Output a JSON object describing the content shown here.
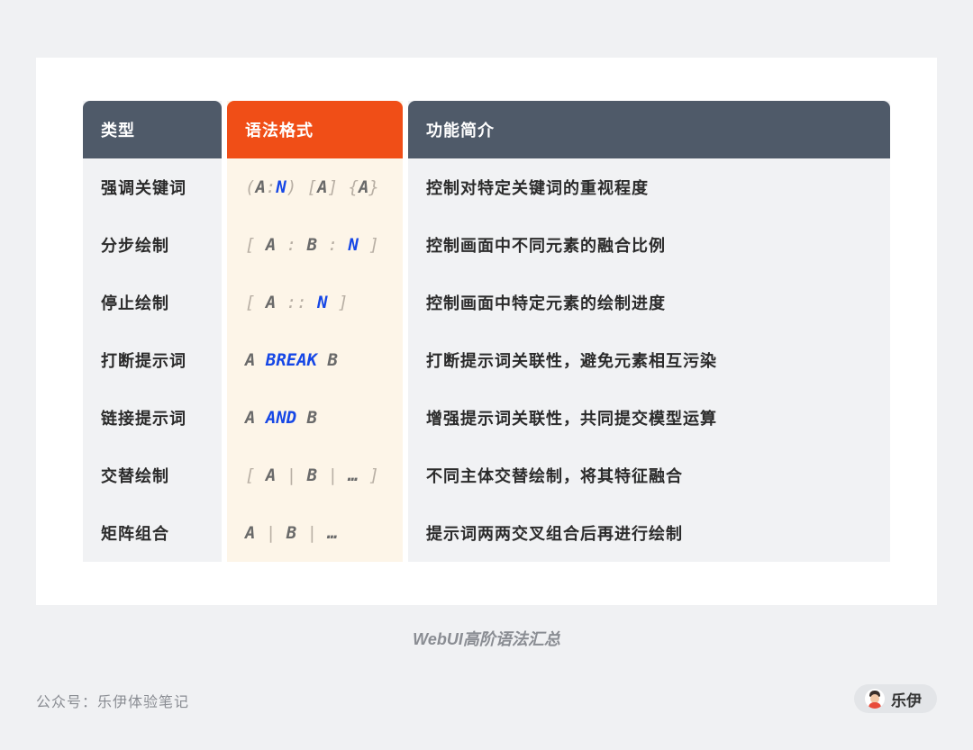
{
  "table": {
    "headers": {
      "type": "类型",
      "syntax": "语法格式",
      "desc": "功能简介"
    },
    "rows": [
      {
        "type": "强调关键词",
        "syntax": [
          {
            "t": "(",
            "k": "bracket"
          },
          {
            "t": "A",
            "k": "letter"
          },
          {
            "t": ":",
            "k": "sep"
          },
          {
            "t": "N",
            "k": "key"
          },
          {
            "t": ") ",
            "k": "bracket"
          },
          {
            "t": "[",
            "k": "bracket"
          },
          {
            "t": "A",
            "k": "letter"
          },
          {
            "t": "] ",
            "k": "bracket"
          },
          {
            "t": "{",
            "k": "bracket"
          },
          {
            "t": "A",
            "k": "letter"
          },
          {
            "t": "}",
            "k": "bracket"
          }
        ],
        "desc": "控制对特定关键词的重视程度"
      },
      {
        "type": "分步绘制",
        "syntax": [
          {
            "t": "[ ",
            "k": "bracket"
          },
          {
            "t": "A",
            "k": "letter"
          },
          {
            "t": " : ",
            "k": "sep"
          },
          {
            "t": "B",
            "k": "letter"
          },
          {
            "t": " : ",
            "k": "sep"
          },
          {
            "t": "N",
            "k": "key"
          },
          {
            "t": " ]",
            "k": "bracket"
          }
        ],
        "desc": "控制画面中不同元素的融合比例"
      },
      {
        "type": "停止绘制",
        "syntax": [
          {
            "t": "[ ",
            "k": "bracket"
          },
          {
            "t": "A",
            "k": "letter"
          },
          {
            "t": " :: ",
            "k": "sep"
          },
          {
            "t": "N",
            "k": "key"
          },
          {
            "t": " ]",
            "k": "bracket"
          }
        ],
        "desc": "控制画面中特定元素的绘制进度"
      },
      {
        "type": "打断提示词",
        "syntax": [
          {
            "t": "A ",
            "k": "letter"
          },
          {
            "t": "BREAK",
            "k": "key"
          },
          {
            "t": " B",
            "k": "letter"
          }
        ],
        "desc": "打断提示词关联性，避免元素相互污染"
      },
      {
        "type": "链接提示词",
        "syntax": [
          {
            "t": "A ",
            "k": "letter"
          },
          {
            "t": "AND",
            "k": "key"
          },
          {
            "t": " B",
            "k": "letter"
          }
        ],
        "desc": "增强提示词关联性，共同提交模型运算"
      },
      {
        "type": "交替绘制",
        "syntax": [
          {
            "t": "[ ",
            "k": "bracket"
          },
          {
            "t": "A",
            "k": "letter"
          },
          {
            "t": " | ",
            "k": "sep"
          },
          {
            "t": "B",
            "k": "letter"
          },
          {
            "t": " | ",
            "k": "sep"
          },
          {
            "t": "…",
            "k": "letter"
          },
          {
            "t": " ]",
            "k": "bracket"
          }
        ],
        "desc": "不同主体交替绘制，将其特征融合"
      },
      {
        "type": "矩阵组合",
        "syntax": [
          {
            "t": "A",
            "k": "letter"
          },
          {
            "t": " | ",
            "k": "sep"
          },
          {
            "t": "B",
            "k": "letter"
          },
          {
            "t": " | ",
            "k": "sep"
          },
          {
            "t": "…",
            "k": "letter"
          }
        ],
        "desc": "提示词两两交叉组合后再进行绘制"
      }
    ]
  },
  "caption": "WebUI高阶语法汇总",
  "footer": {
    "account": "公众号：乐伊体验笔记",
    "author": "乐伊"
  },
  "colors": {
    "header_dark": "#4f5a69",
    "header_accent": "#f04e17",
    "keyword_blue": "#1647e6"
  }
}
